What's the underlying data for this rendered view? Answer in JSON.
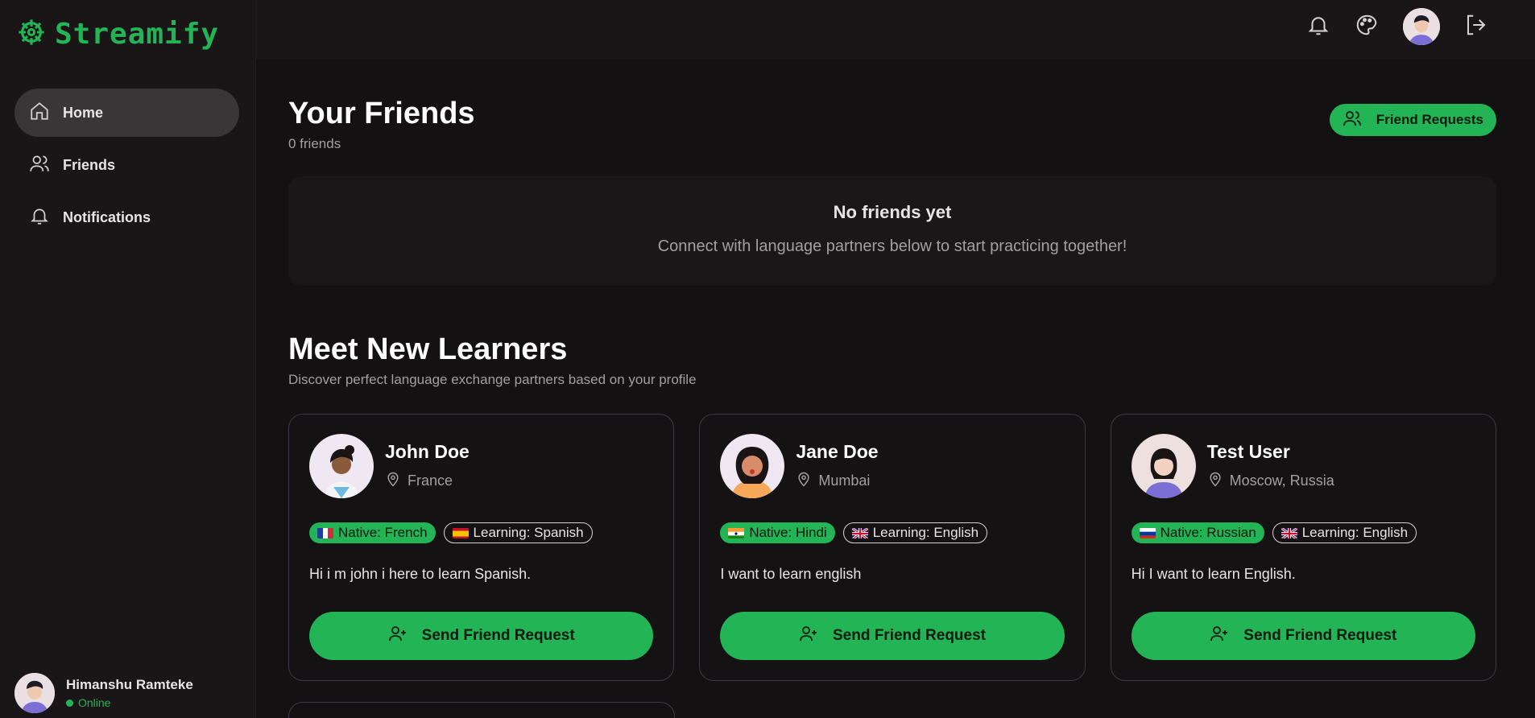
{
  "app": {
    "name": "Streamify"
  },
  "sidebar": {
    "items": [
      {
        "label": "Home",
        "icon": "home-icon",
        "active": true
      },
      {
        "label": "Friends",
        "icon": "users-icon",
        "active": false
      },
      {
        "label": "Notifications",
        "icon": "bell-icon",
        "active": false
      }
    ],
    "user": {
      "name": "Himanshu Ramteke",
      "status": "Online"
    }
  },
  "topbar": {
    "icons": [
      "bell-icon",
      "palette-icon",
      "avatar",
      "logout-icon"
    ]
  },
  "friends": {
    "title": "Your Friends",
    "count_label": "0 friends",
    "requests_button": "Friend Requests",
    "empty_title": "No friends yet",
    "empty_desc": "Connect with language partners below to start practicing together!"
  },
  "learners": {
    "title": "Meet New Learners",
    "subtitle": "Discover perfect language exchange partners based on your profile",
    "cards": [
      {
        "name": "John Doe",
        "location": "France",
        "native": "Native: French",
        "learning": "Learning: Spanish",
        "bio": "Hi i m john i here to learn Spanish.",
        "button": "Send Friend Request"
      },
      {
        "name": "Jane Doe",
        "location": "Mumbai",
        "native": "Native: Hindi",
        "learning": "Learning: English",
        "bio": "I want to learn english",
        "button": "Send Friend Request"
      },
      {
        "name": "Test User",
        "location": "Moscow, Russia",
        "native": "Native: Russian",
        "learning": "Learning: English",
        "bio": "Hi I want to learn English.",
        "button": "Send Friend Request"
      }
    ]
  },
  "colors": {
    "accent": "#22b455",
    "background": "#141112",
    "sidebar": "#1a1617"
  }
}
